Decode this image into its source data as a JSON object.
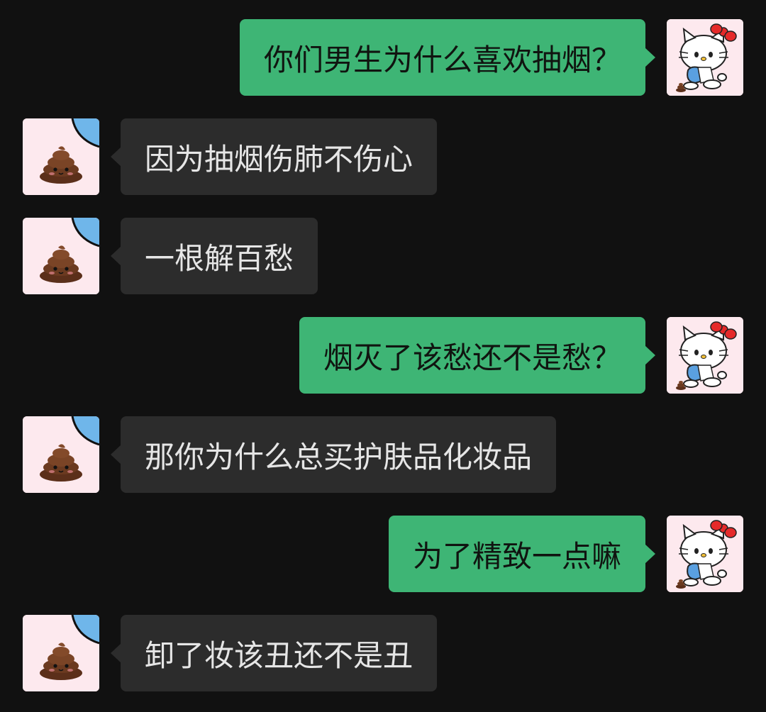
{
  "colors": {
    "background": "#111111",
    "received_bubble": "#2c2c2c",
    "sent_bubble": "#3eb575",
    "received_text": "#e6e6e6",
    "sent_text": "#101410"
  },
  "messages": [
    {
      "side": "right",
      "avatar": "hello-kitty-avatar",
      "text": "你们男生为什么喜欢抽烟？"
    },
    {
      "side": "left",
      "avatar": "poop-emoji-avatar",
      "text": "因为抽烟伤肺不伤心"
    },
    {
      "side": "left",
      "avatar": "poop-emoji-avatar",
      "text": "一根解百愁"
    },
    {
      "side": "right",
      "avatar": "hello-kitty-avatar",
      "text": "烟灭了该愁还不是愁？"
    },
    {
      "side": "left",
      "avatar": "poop-emoji-avatar",
      "text": "那你为什么总买护肤品化妆品"
    },
    {
      "side": "right",
      "avatar": "hello-kitty-avatar",
      "text": "为了精致一点嘛"
    },
    {
      "side": "left",
      "avatar": "poop-emoji-avatar",
      "text": "卸了妆该丑还不是丑"
    }
  ]
}
